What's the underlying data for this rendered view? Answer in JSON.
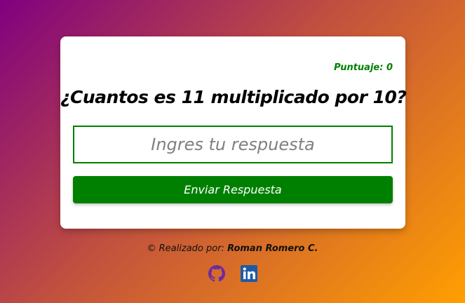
{
  "game": {
    "score_label": "Puntuaje:",
    "score_value": "0",
    "question": "¿Cuantos es 11 multiplicado por 10?",
    "answer_value": "",
    "answer_placeholder": "Ingres tu respuesta",
    "submit_label": "Enviar Respuesta"
  },
  "footer": {
    "prefix": "© Realizado por:",
    "author": "Roman Romero C."
  },
  "social": {
    "links": [
      {
        "icon": "github-icon"
      },
      {
        "icon": "linkedin-icon"
      }
    ]
  },
  "colors": {
    "accent": "#008000",
    "github": "#6e2aa0",
    "linkedin": "#1f5aa6"
  }
}
